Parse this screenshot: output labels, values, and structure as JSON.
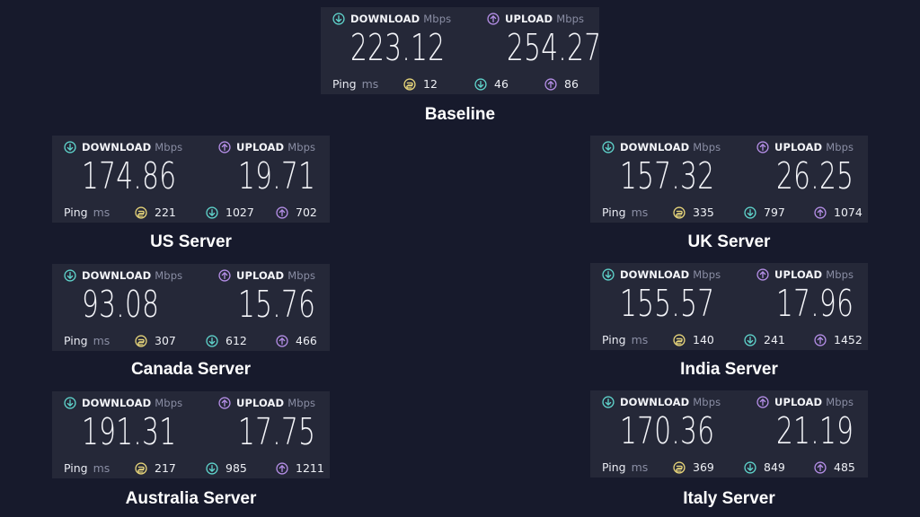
{
  "labels": {
    "download": "DOWNLOAD",
    "upload": "UPLOAD",
    "speed_unit": "Mbps",
    "ping": "Ping",
    "ping_unit": "ms"
  },
  "colors": {
    "background": "#171a2c",
    "panel": "#252838",
    "download_icon": "#5fd3cb",
    "upload_icon": "#b48ee6",
    "idle_icon": "#e7d57a"
  },
  "icons": {
    "download": "arrow-down-circle-icon",
    "upload": "arrow-up-circle-icon",
    "idle": "idle-latency-icon"
  },
  "results": [
    {
      "title": "Baseline",
      "download": "223.12",
      "upload": "254.27",
      "ping_idle": "12",
      "ping_download": "46",
      "ping_upload": "86"
    },
    {
      "title": "US Server",
      "download": "174.86",
      "upload": "19.71",
      "ping_idle": "221",
      "ping_download": "1027",
      "ping_upload": "702"
    },
    {
      "title": "UK Server",
      "download": "157.32",
      "upload": "26.25",
      "ping_idle": "335",
      "ping_download": "797",
      "ping_upload": "1074"
    },
    {
      "title": "Canada Server",
      "download": "93.08",
      "upload": "15.76",
      "ping_idle": "307",
      "ping_download": "612",
      "ping_upload": "466"
    },
    {
      "title": "India Server",
      "download": "155.57",
      "upload": "17.96",
      "ping_idle": "140",
      "ping_download": "241",
      "ping_upload": "1452"
    },
    {
      "title": "Australia Server",
      "download": "191.31",
      "upload": "17.75",
      "ping_idle": "217",
      "ping_download": "985",
      "ping_upload": "1211"
    },
    {
      "title": "Italy Server",
      "download": "170.36",
      "upload": "21.19",
      "ping_idle": "369",
      "ping_download": "849",
      "ping_upload": "485"
    }
  ]
}
